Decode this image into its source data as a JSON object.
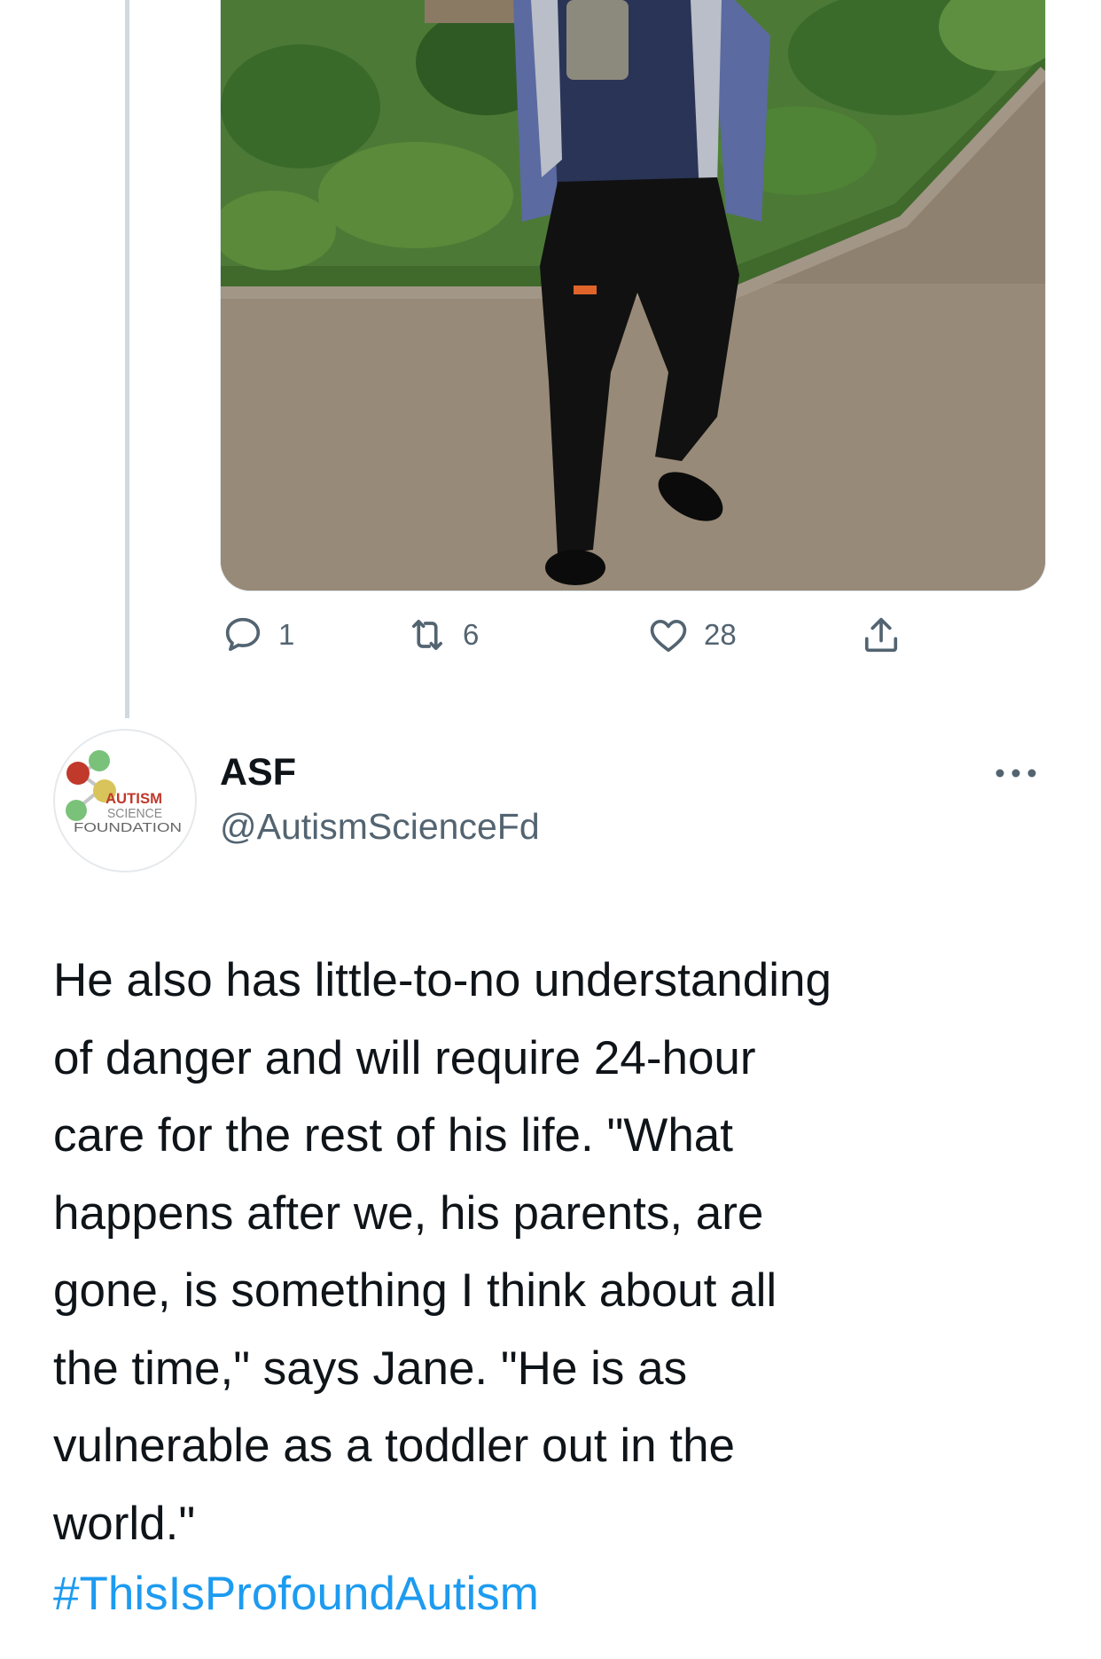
{
  "previous_tweet": {
    "actions": {
      "reply_count": "1",
      "retweet_count": "6",
      "like_count": "28"
    }
  },
  "tweet": {
    "display_name": "ASF",
    "handle": "@AutismScienceFd",
    "avatar_logo_text": [
      "AUTISM",
      "SCIENCE",
      "FOUNDATION"
    ],
    "text": "He also has little-to-no understanding\nof danger and will require 24-hour\ncare for the rest of his life. \"What\nhappens after we, his parents, are\ngone, is something I think about all\nthe time,\" says Jane. \"He is as\nvulnerable as a toddler out in the\nworld.\"",
    "hashtag": "#ThisIsProfoundAutism"
  },
  "colors": {
    "text_primary": "#0f1419",
    "text_secondary": "#536471",
    "link": "#1d9bf0",
    "thread_line": "#cfd9de",
    "logo_red": "#c0392b",
    "logo_green": "#7ac27a"
  },
  "icons": {
    "reply": "speech-bubble-icon",
    "retweet": "retweet-arrows-icon",
    "like": "heart-icon",
    "share": "share-upload-icon",
    "more": "more-dots-icon"
  }
}
